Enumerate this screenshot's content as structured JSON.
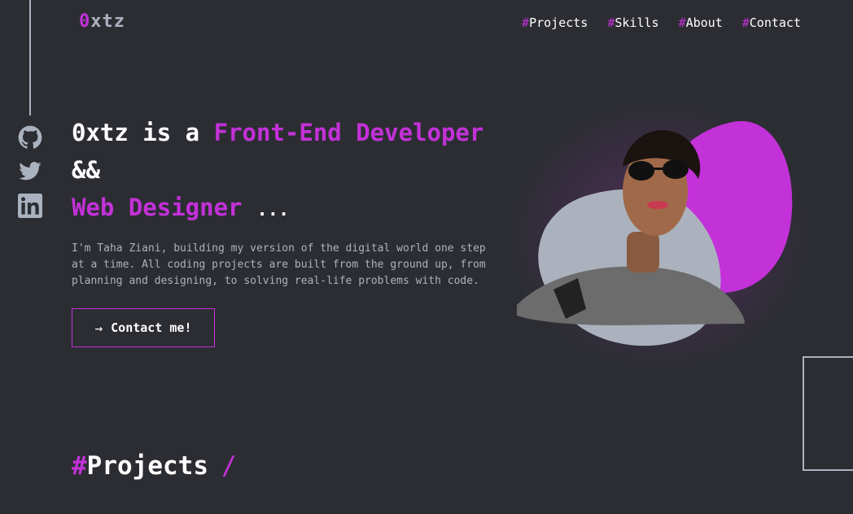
{
  "logo": {
    "accent": "0",
    "rest": "xtz"
  },
  "nav": {
    "hash": "#",
    "items": [
      {
        "label": "Projects"
      },
      {
        "label": "Skills"
      },
      {
        "label": "About"
      },
      {
        "label": "Contact"
      }
    ]
  },
  "social": {
    "github_icon": "github-icon",
    "twitter_icon": "twitter-icon",
    "linkedin_icon": "linkedin-icon"
  },
  "hero": {
    "line1_prefix": "0xtz is a ",
    "role1": "Front-End Developer",
    "conjunction": "&&",
    "role2": "Web Designer",
    "ellipsis": "...",
    "description": "I'm Taha Ziani, building my version of the digital world one step at a time. All coding projects are built from the ground up, from planning and designing, to solving real-life problems with code.",
    "cta_arrow": "→",
    "cta_label": "Contact me!"
  },
  "section": {
    "hash": "#",
    "title": "Projects",
    "slash": "/"
  },
  "colors": {
    "accent": "#c331d8",
    "background": "#2c2d33",
    "muted": "#abb2bf"
  }
}
